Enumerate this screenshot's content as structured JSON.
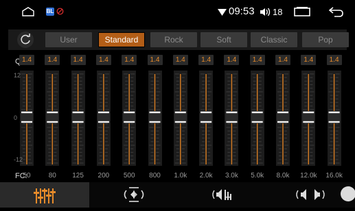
{
  "status_bar": {
    "time": "09:53",
    "volume": "18",
    "app_badge_text": "BL"
  },
  "presets": {
    "items": [
      "User",
      "Standard",
      "Rock",
      "Soft",
      "Classic",
      "Pop"
    ],
    "active": "Standard"
  },
  "eq": {
    "q_label": "Q:",
    "q_values": [
      "1.4",
      "1.4",
      "1.4",
      "1.4",
      "1.4",
      "1.4",
      "1.4",
      "1.4",
      "1.4",
      "1.4",
      "1.4",
      "1.4",
      "1.4"
    ],
    "scale": {
      "top": "12",
      "mid": "0",
      "bottom": "-12"
    },
    "fc_label": "FC:",
    "frequencies": [
      "50",
      "80",
      "125",
      "200",
      "500",
      "800",
      "1.0k",
      "2.0k",
      "3.0k",
      "5.0k",
      "8.0k",
      "12.0k",
      "16.0k"
    ]
  },
  "bottom_nav": {
    "tabs": [
      "equalizer-icon",
      "surround-icon",
      "speaker-balance-icon",
      "loudness-icon"
    ],
    "active": 0
  },
  "colors": {
    "accent": "#b35e17",
    "q_text": "#e88b2a",
    "slider_track": "#d07a24"
  }
}
